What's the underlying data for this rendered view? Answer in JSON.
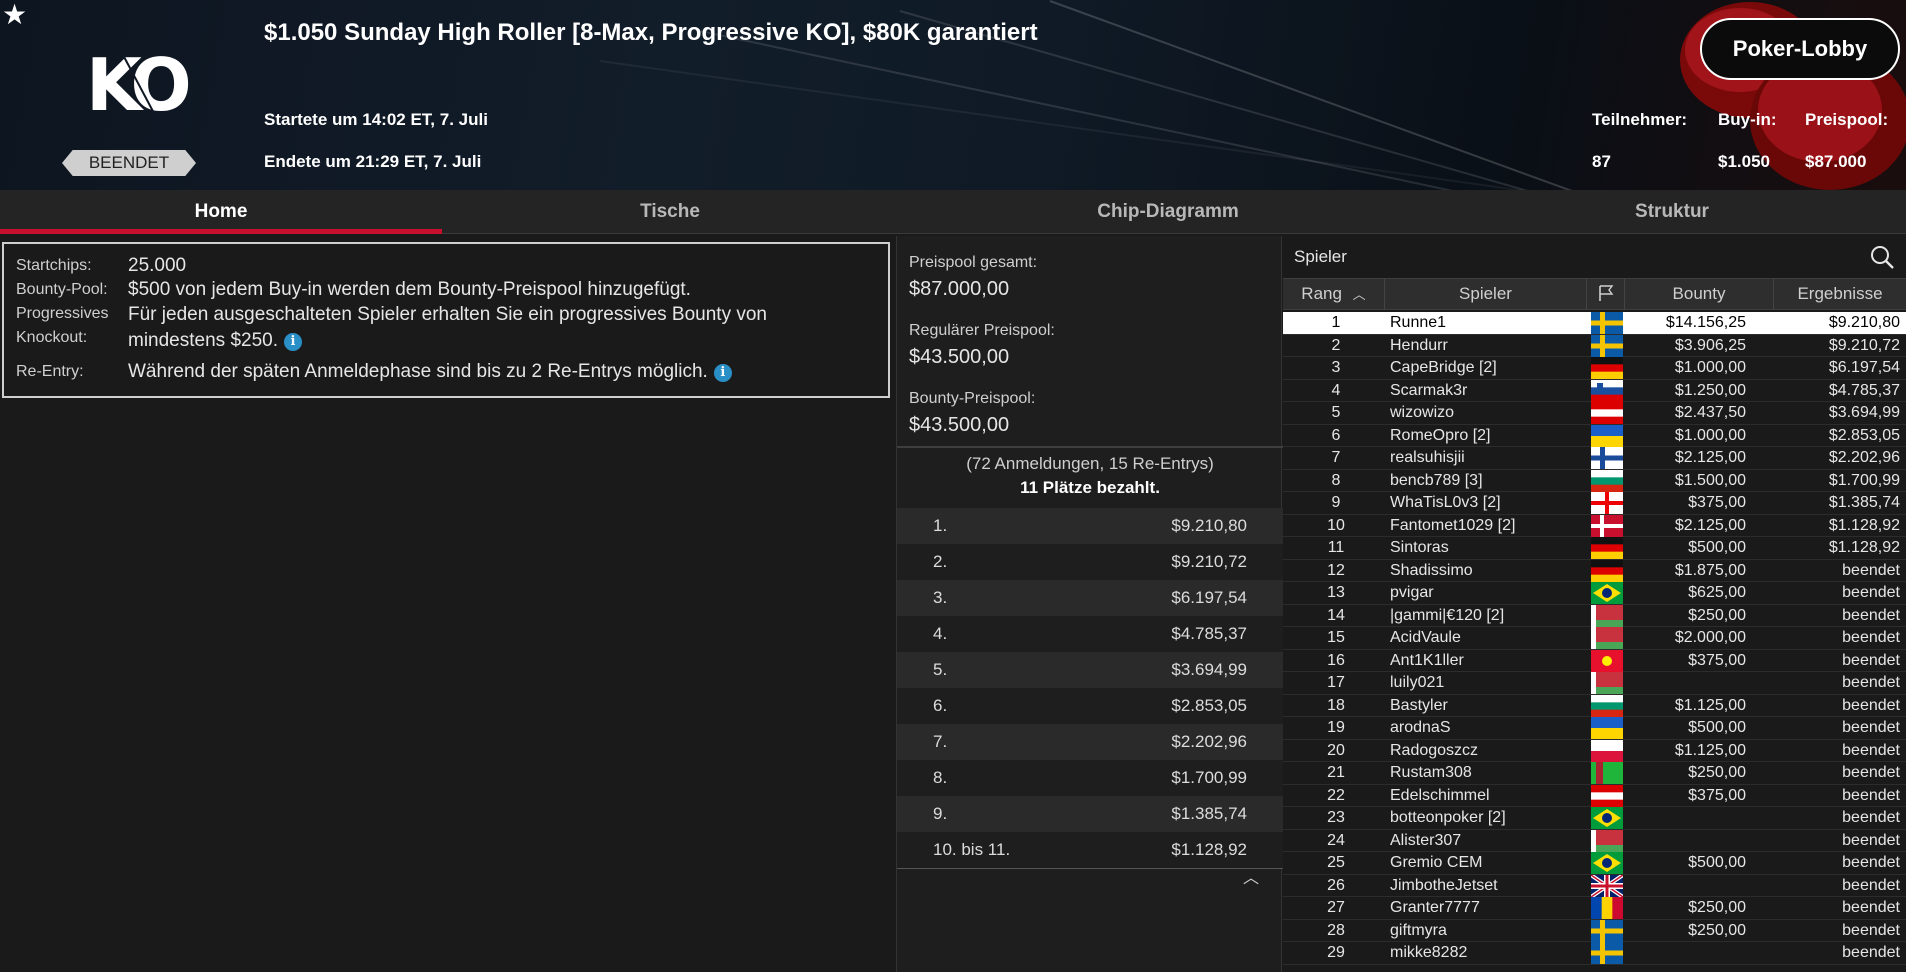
{
  "header": {
    "title": "$1.050 Sunday High Roller [8-Max, Progressive KO], $80K garantiert",
    "logo_text": "KO",
    "status": "BEENDET",
    "started": "Startete um 14:02 ET, 7. Juli",
    "ended": "Endete um 21:29 ET, 7. Juli",
    "lobby_button": "Poker-Lobby",
    "stats": {
      "entrants_label": "Teilnehmer:",
      "entrants": "87",
      "buyin_label": "Buy-in:",
      "buyin": "$1.050",
      "prizepool_label": "Preispool:",
      "prizepool": "$87.000"
    }
  },
  "tabs": [
    "Home",
    "Tische",
    "Chip-Diagramm",
    "Struktur"
  ],
  "info": [
    {
      "label": "Startchips:",
      "text": "25.000",
      "info_icon": false
    },
    {
      "label": "Bounty-Pool:",
      "text": "$500 von jedem Buy-in werden dem Bounty-Preispool hinzugefügt.",
      "info_icon": false
    },
    {
      "label": "Progressives Knockout:",
      "text": "Für jeden ausgeschalteten Spieler erhalten Sie ein progressives Bounty von mindestens $250.",
      "info_icon": true
    },
    {
      "label": "Re-Entry:",
      "text": "Während der späten Anmeldephase sind bis zu 2 Re-Entrys möglich.",
      "info_icon": true
    }
  ],
  "prizepool": {
    "total_label": "Preispool gesamt:",
    "total": "$87.000,00",
    "regular_label": "Regulärer Preispool:",
    "regular": "$43.500,00",
    "bounty_label": "Bounty-Preispool:",
    "bounty": "$43.500,00",
    "entries": "(72 Anmeldungen, 15 Re-Entrys)",
    "paid": "11 Plätze bezahlt.",
    "payouts": [
      {
        "place": "1.",
        "amount": "$9.210,80"
      },
      {
        "place": "2.",
        "amount": "$9.210,72"
      },
      {
        "place": "3.",
        "amount": "$6.197,54"
      },
      {
        "place": "4.",
        "amount": "$4.785,37"
      },
      {
        "place": "5.",
        "amount": "$3.694,99"
      },
      {
        "place": "6.",
        "amount": "$2.853,05"
      },
      {
        "place": "7.",
        "amount": "$2.202,96"
      },
      {
        "place": "8.",
        "amount": "$1.700,99"
      },
      {
        "place": "9.",
        "amount": "$1.385,74"
      },
      {
        "place": "10. bis 11.",
        "amount": "$1.128,92"
      }
    ]
  },
  "players": {
    "search_label": "Spieler",
    "columns": [
      "Rang",
      "Spieler",
      "Bounty",
      "Ergebnisse"
    ],
    "rows": [
      {
        "rank": "1",
        "name": "Runne1",
        "flag": "se",
        "bounty": "$14.156,25",
        "result": "$9.210,80"
      },
      {
        "rank": "2",
        "name": "Hendurr",
        "flag": "se",
        "bounty": "$3.906,25",
        "result": "$9.210,72"
      },
      {
        "rank": "3",
        "name": "CapeBridge [2]",
        "flag": "de",
        "bounty": "$1.000,00",
        "result": "$6.197,54"
      },
      {
        "rank": "4",
        "name": "Scarmak3r",
        "flag": "si",
        "bounty": "$1.250,00",
        "result": "$4.785,37"
      },
      {
        "rank": "5",
        "name": "wizowizo",
        "flag": "at",
        "bounty": "$2.437,50",
        "result": "$3.694,99"
      },
      {
        "rank": "6",
        "name": "RomeOpro [2]",
        "flag": "ua",
        "bounty": "$1.000,00",
        "result": "$2.853,05"
      },
      {
        "rank": "7",
        "name": "realsuhisjii",
        "flag": "fi",
        "bounty": "$2.125,00",
        "result": "$2.202,96"
      },
      {
        "rank": "8",
        "name": "bencb789 [3]",
        "flag": "bg",
        "bounty": "$1.500,00",
        "result": "$1.700,99"
      },
      {
        "rank": "9",
        "name": "WhaTisL0v3 [2]",
        "flag": "ge",
        "bounty": "$375,00",
        "result": "$1.385,74"
      },
      {
        "rank": "10",
        "name": "Fantomet1029 [2]",
        "flag": "dk",
        "bounty": "$2.125,00",
        "result": "$1.128,92"
      },
      {
        "rank": "11",
        "name": "Sintoras",
        "flag": "de",
        "bounty": "$500,00",
        "result": "$1.128,92"
      },
      {
        "rank": "12",
        "name": "Shadissimo",
        "flag": "de",
        "bounty": "$1.875,00",
        "result": "beendet"
      },
      {
        "rank": "13",
        "name": "pvigar",
        "flag": "br",
        "bounty": "$625,00",
        "result": "beendet"
      },
      {
        "rank": "14",
        "name": "|gammi|€120 [2]",
        "flag": "by",
        "bounty": "$250,00",
        "result": "beendet"
      },
      {
        "rank": "15",
        "name": "AcidVaule",
        "flag": "by",
        "bounty": "$2.000,00",
        "result": "beendet"
      },
      {
        "rank": "16",
        "name": "Ant1K1ller",
        "flag": "kg",
        "bounty": "$375,00",
        "result": "beendet"
      },
      {
        "rank": "17",
        "name": "luily021",
        "flag": "by",
        "bounty": "",
        "result": "beendet"
      },
      {
        "rank": "18",
        "name": "Bastyler",
        "flag": "bg",
        "bounty": "$1.125,00",
        "result": "beendet"
      },
      {
        "rank": "19",
        "name": "arodnaS",
        "flag": "ua",
        "bounty": "$500,00",
        "result": "beendet"
      },
      {
        "rank": "20",
        "name": "Radogoszcz",
        "flag": "pl",
        "bounty": "$1.125,00",
        "result": "beendet"
      },
      {
        "rank": "21",
        "name": "Rustam308",
        "flag": "tm",
        "bounty": "$250,00",
        "result": "beendet"
      },
      {
        "rank": "22",
        "name": "Edelschimmel",
        "flag": "at",
        "bounty": "$375,00",
        "result": "beendet"
      },
      {
        "rank": "23",
        "name": "botteonpoker [2]",
        "flag": "br",
        "bounty": "",
        "result": "beendet"
      },
      {
        "rank": "24",
        "name": "Alister307",
        "flag": "by",
        "bounty": "",
        "result": "beendet"
      },
      {
        "rank": "25",
        "name": "Gremio CEM",
        "flag": "br",
        "bounty": "$500,00",
        "result": "beendet"
      },
      {
        "rank": "26",
        "name": "JimbotheJetset",
        "flag": "gb",
        "bounty": "",
        "result": "beendet"
      },
      {
        "rank": "27",
        "name": "Granter7777",
        "flag": "md",
        "bounty": "$250,00",
        "result": "beendet"
      },
      {
        "rank": "28",
        "name": "giftmyra",
        "flag": "se",
        "bounty": "$250,00",
        "result": "beendet"
      },
      {
        "rank": "29",
        "name": "mikke8282",
        "flag": "se",
        "bounty": "",
        "result": "beendet"
      }
    ]
  }
}
